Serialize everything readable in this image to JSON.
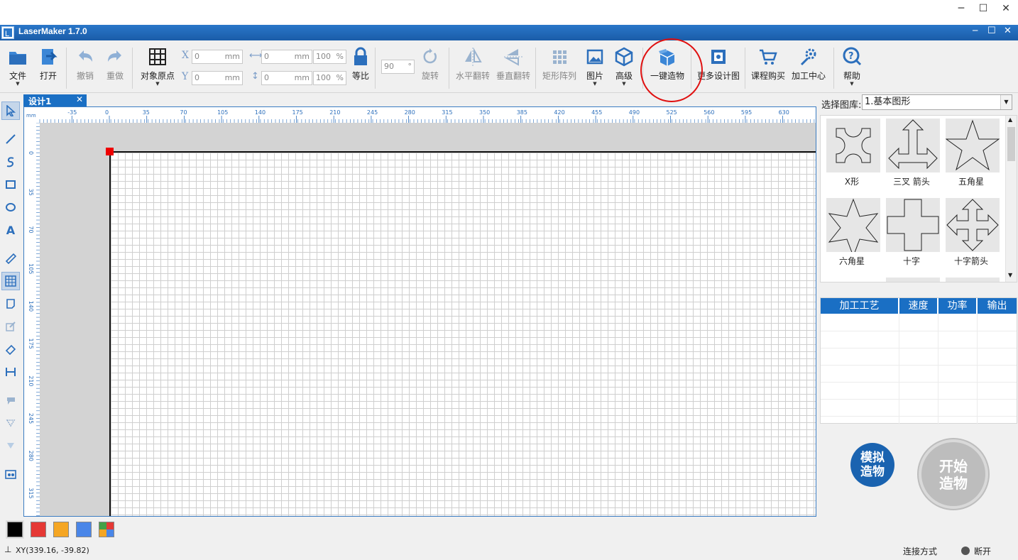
{
  "window": {
    "minimize": "─",
    "maximize": "☐",
    "close": "✕"
  },
  "app": {
    "title": "LaserMaker 1.7.0",
    "min": "─",
    "max": "☐",
    "close": "✕"
  },
  "toolbar": {
    "file": "文件",
    "open": "打开",
    "undo": "撤销",
    "redo": "重做",
    "origin": "对象原点",
    "x_label": "X",
    "y_label": "Y",
    "x_value": "0",
    "y_value": "0",
    "unit": "mm",
    "w_value": "0",
    "h_value": "0",
    "w_pct": "100",
    "h_pct": "100",
    "pct": "%",
    "ratio": "等比",
    "angle": "90",
    "deg": "°",
    "rotate": "旋转",
    "hflip": "水平翻转",
    "vflip": "垂直翻转",
    "array": "矩形阵列",
    "image": "图片",
    "advanced": "高级",
    "oneclick": "一键造物",
    "more_designs": "更多设计图",
    "course": "课程购买",
    "center": "加工中心",
    "help": "帮助"
  },
  "tabs": {
    "design": "设计1",
    "close": "✕"
  },
  "ruler": {
    "unit": "mm",
    "top_ticks": [
      "-35",
      "0",
      "35",
      "70",
      "105",
      "140",
      "175",
      "210",
      "245",
      "280",
      "315",
      "350",
      "385",
      "420",
      "455",
      "490",
      "525",
      "560",
      "595",
      "630"
    ],
    "left_ticks": [
      "0",
      "35",
      "70",
      "105",
      "140",
      "175",
      "210",
      "245",
      "280",
      "315"
    ]
  },
  "library": {
    "label": "选择图库:",
    "selected": "1.基本图形",
    "shapes": [
      "X形",
      "三叉 箭头",
      "五角星",
      "六角星",
      "十字",
      "十字箭头"
    ]
  },
  "process_table": {
    "headers": [
      "加工工艺",
      "速度",
      "功率",
      "输出"
    ]
  },
  "buttons": {
    "simulate": "模拟造物",
    "start": "开始造物"
  },
  "colors": [
    "#000000",
    "#e53935",
    "#f5a623",
    "#4a86e8",
    "multi"
  ],
  "status": {
    "xy": "XY(339.16, -39.82)",
    "connection": "连接方式",
    "disconnected": "断开"
  }
}
